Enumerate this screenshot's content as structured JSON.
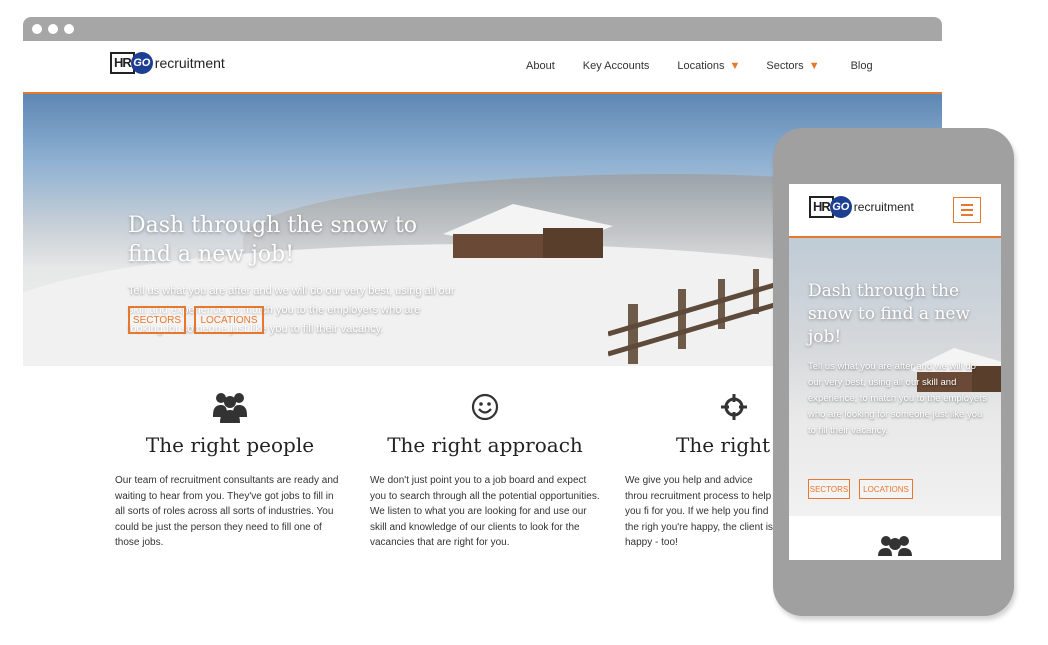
{
  "brand": {
    "logo_hr": "HR",
    "logo_go": "GO",
    "logo_word": "recruitment",
    "accent": "#e8772e",
    "logo_blue": "#1d3f93"
  },
  "nav": {
    "items": [
      {
        "label": "About"
      },
      {
        "label": "Key Accounts"
      },
      {
        "label": "Locations",
        "dropdown": true
      },
      {
        "label": "Sectors",
        "dropdown": true
      },
      {
        "label": "Blog"
      }
    ]
  },
  "hero": {
    "title": "Dash through the snow to find a new job!",
    "text": "Tell us what you are after and we will do our very best, using all our skill and experience, to match you to the employers who are looking for someone just like you to fill their vacancy.",
    "button_sectors": "SECTORS",
    "button_locations": "LOCATIONS"
  },
  "features": [
    {
      "icon": "group-icon",
      "title": "The right people",
      "text": "Our team of recruitment consultants are ready and waiting to hear from you. They've got jobs to fill in all sorts of roles across all sorts of industries. You could be just the person they need to fill one of those jobs."
    },
    {
      "icon": "smiley-icon",
      "title": "The right approach",
      "text": "We don't just point you to a job board and expect you to search through all the potential opportunities. We listen to what you are looking for and use our skill and knowledge of our clients to look for the vacancies that are right for you."
    },
    {
      "icon": "crosshair-icon",
      "title": "The right j",
      "text": "We give you help and advice throu recruitment process to help you fi for you. If we help you find the righ you're happy, the client is happy - too!"
    }
  ],
  "mobile": {
    "hero_title": "Dash through the snow to find a new job!",
    "hero_text": "Tell us what you are after and we will do our very best, using all our skill and experience, to match you to the employers who are looking for someone just like you to fill their vacancy.",
    "button_sectors": "SECTORS",
    "button_locations": "LOCATIONS"
  }
}
